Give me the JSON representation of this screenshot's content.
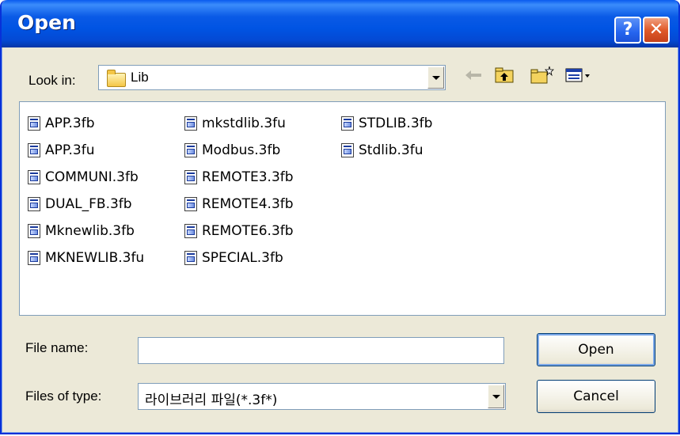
{
  "window": {
    "title": "Open",
    "help_glyph": "?",
    "close_glyph": "✕"
  },
  "lookin": {
    "label": "Look in:",
    "value": "Lib"
  },
  "toolbar": {
    "back_icon": "back-arrow-icon",
    "up_icon": "up-folder-icon",
    "new_icon": "new-folder-icon",
    "view_icon": "view-menu-icon"
  },
  "files": {
    "columns": [
      [
        "APP.3fb",
        "APP.3fu",
        "COMMUNI.3fb",
        "DUAL_FB.3fb",
        "Mknewlib.3fb",
        "MKNEWLIB.3fu"
      ],
      [
        "mkstdlib.3fu",
        "Modbus.3fb",
        "REMOTE3.3fb",
        "REMOTE4.3fb",
        "REMOTE6.3fb",
        "SPECIAL.3fb"
      ],
      [
        "STDLIB.3fb",
        "Stdlib.3fu"
      ]
    ]
  },
  "filename": {
    "label": "File name:",
    "value": ""
  },
  "filetype": {
    "label": "Files of type:",
    "value": "라이브러리 파일(*.3f*)"
  },
  "buttons": {
    "open": "Open",
    "cancel": "Cancel"
  },
  "colors": {
    "titlebar": "#0054e3",
    "face": "#ece9d8",
    "border": "#7f9db9"
  }
}
